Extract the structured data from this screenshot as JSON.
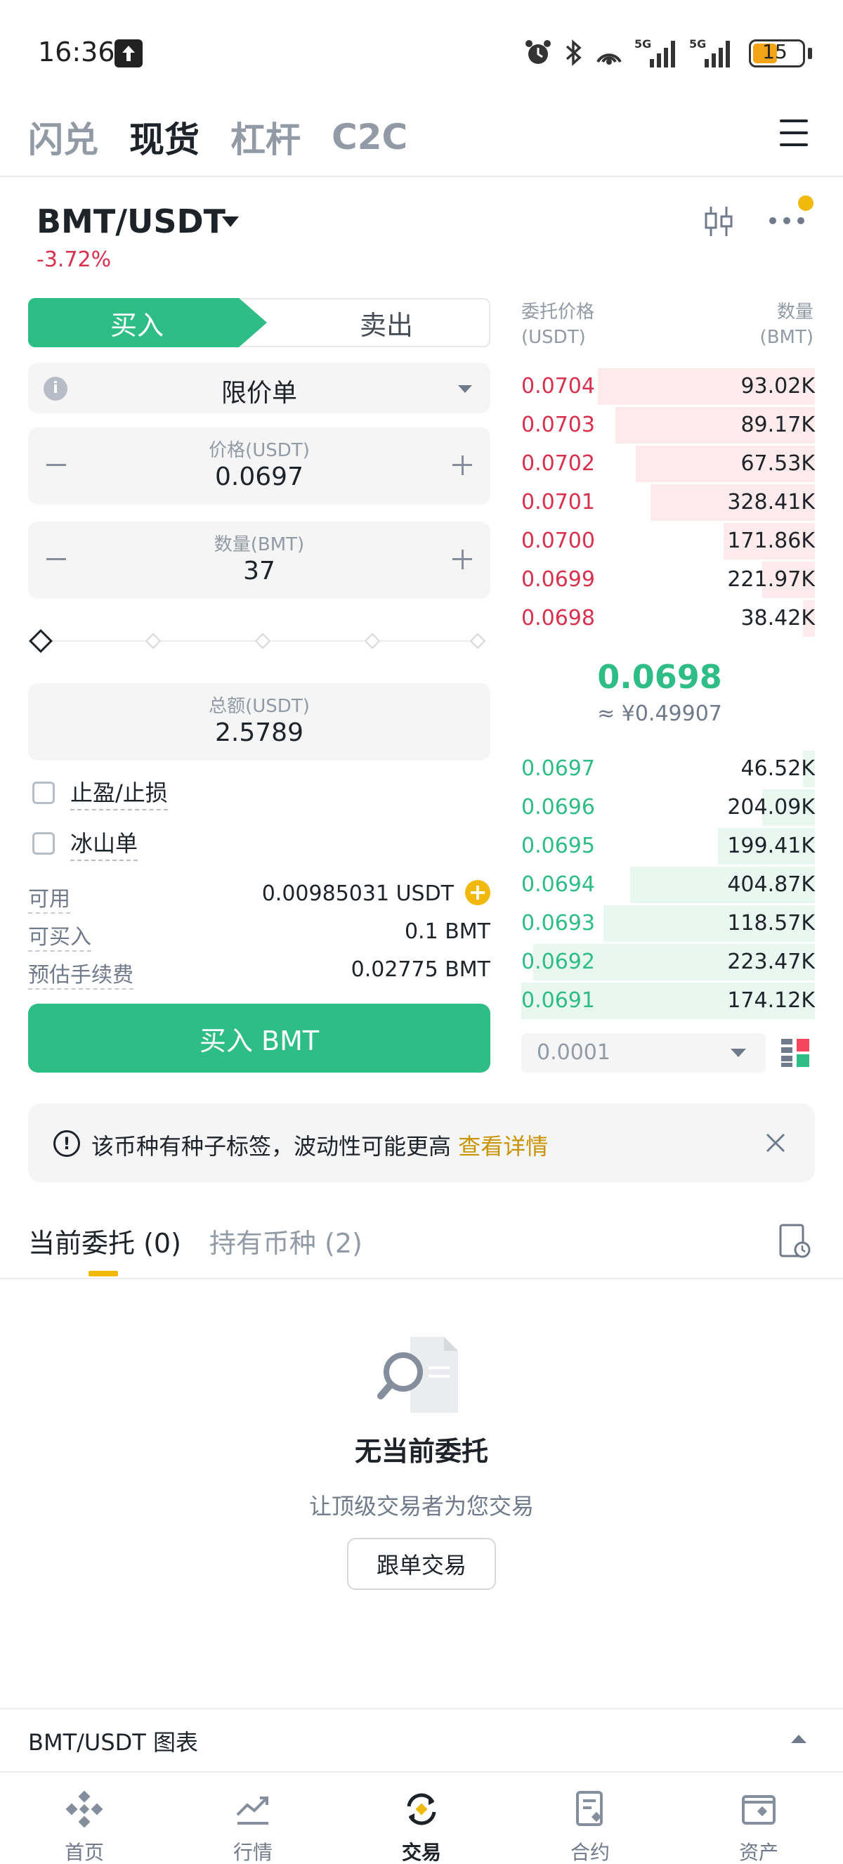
{
  "status_bar": {
    "time": "16:36",
    "battery": "15",
    "icons": [
      "upload-icon",
      "alarm-icon",
      "bluetooth-icon",
      "hotspot-icon",
      "signal-5g-icon",
      "signal-5g-icon"
    ]
  },
  "top_nav": {
    "tabs": [
      {
        "label": "闪兑",
        "active": false
      },
      {
        "label": "现货",
        "active": true
      },
      {
        "label": "杠杆",
        "active": false
      },
      {
        "label": "C2C",
        "active": false
      }
    ]
  },
  "pair": {
    "symbol": "BMT/USDT",
    "change": "-3.72%"
  },
  "order_form": {
    "buy_label": "买入",
    "sell_label": "卖出",
    "order_type": "限价单",
    "price_label": "价格(USDT)",
    "price_value": "0.0697",
    "qty_label": "数量(BMT)",
    "qty_value": "37",
    "total_label": "总额(USDT)",
    "total_value": "2.5789",
    "tp_sl_label": "止盈/止损",
    "iceberg_label": "冰山单",
    "available_label": "可用",
    "available_value": "0.00985031 USDT",
    "max_buy_label": "可买入",
    "max_buy_value": "0.1 BMT",
    "fee_label": "预估手续费",
    "fee_value": "0.02775 BMT",
    "submit_label": "买入 BMT"
  },
  "order_book": {
    "price_header": "委托价格",
    "price_unit": "(USDT)",
    "qty_header": "数量",
    "qty_unit": "(BMT)",
    "asks": [
      {
        "price": "0.0704",
        "qty": "93.02K",
        "depth": 0.74
      },
      {
        "price": "0.0703",
        "qty": "89.17K",
        "depth": 0.68
      },
      {
        "price": "0.0702",
        "qty": "67.53K",
        "depth": 0.61
      },
      {
        "price": "0.0701",
        "qty": "328.41K",
        "depth": 0.56
      },
      {
        "price": "0.0700",
        "qty": "171.86K",
        "depth": 0.31
      },
      {
        "price": "0.0699",
        "qty": "221.97K",
        "depth": 0.18
      },
      {
        "price": "0.0698",
        "qty": "38.42K",
        "depth": 0.04
      }
    ],
    "mid_price": "0.0698",
    "mid_cny": "≈ ¥0.49907",
    "bids": [
      {
        "price": "0.0697",
        "qty": "46.52K",
        "depth": 0.04
      },
      {
        "price": "0.0696",
        "qty": "204.09K",
        "depth": 0.18
      },
      {
        "price": "0.0695",
        "qty": "199.41K",
        "depth": 0.33
      },
      {
        "price": "0.0694",
        "qty": "404.87K",
        "depth": 0.63
      },
      {
        "price": "0.0693",
        "qty": "118.57K",
        "depth": 0.72
      },
      {
        "price": "0.0692",
        "qty": "223.47K",
        "depth": 0.96
      },
      {
        "price": "0.0691",
        "qty": "174.12K",
        "depth": 1.0
      }
    ],
    "precision": "0.0001"
  },
  "notice": {
    "text": "该币种有种子标签，波动性可能更高",
    "link": "查看详情"
  },
  "orders": {
    "tab_current": "当前委托 (0)",
    "tab_holdings": "持有币种 (2)",
    "empty_title": "无当前委托",
    "empty_sub": "让顶级交易者为您交易",
    "copy_trade_label": "跟单交易"
  },
  "chart_panel": {
    "label": "BMT/USDT 图表"
  },
  "bottom_nav": [
    {
      "label": "首页",
      "icon": "home-icon",
      "active": false
    },
    {
      "label": "行情",
      "icon": "markets-icon",
      "active": false
    },
    {
      "label": "交易",
      "icon": "trade-icon",
      "active": true
    },
    {
      "label": "合约",
      "icon": "futures-icon",
      "active": false
    },
    {
      "label": "资产",
      "icon": "wallet-icon",
      "active": false
    }
  ],
  "colors": {
    "buy_green": "#2ebd85",
    "sell_red": "#d9304e",
    "brand_yellow": "#f0b90b"
  }
}
